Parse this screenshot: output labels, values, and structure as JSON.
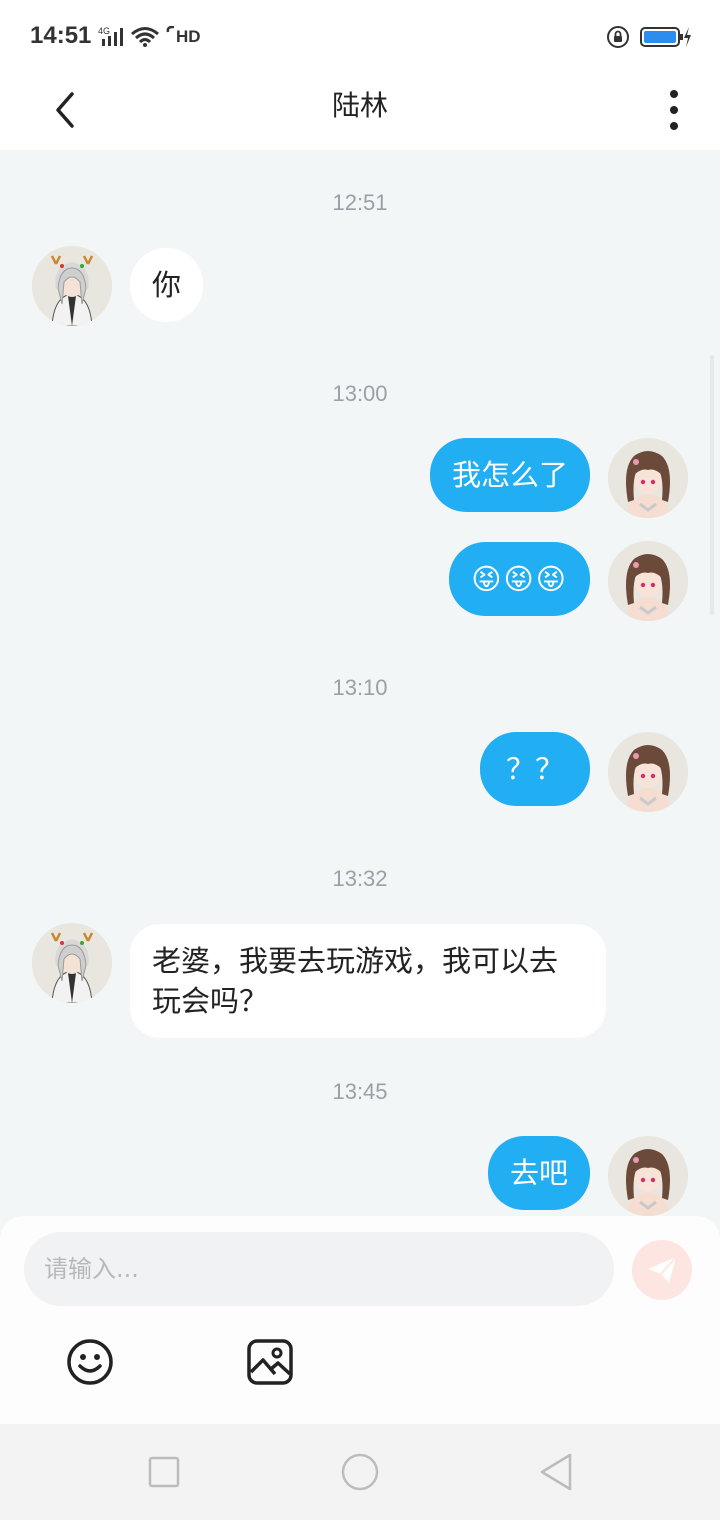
{
  "status_bar": {
    "time": "14:51",
    "network": "4G",
    "hd": "HD",
    "icons": [
      "signal-icon",
      "wifi-icon",
      "hd-call-icon",
      "rotation-lock-icon",
      "battery-charging-icon"
    ],
    "battery_color": "#2d8cf0"
  },
  "header": {
    "title": "陆林",
    "back_icon": "chevron-left-icon",
    "more_icon": "more-vertical-icon"
  },
  "messages": [
    {
      "timestamp": "12:51"
    },
    {
      "direction": "in",
      "text": "你",
      "sender": "contact"
    },
    {
      "timestamp": "13:00"
    },
    {
      "direction": "out",
      "text": "我怎么了",
      "sender": "me"
    },
    {
      "direction": "out",
      "text": "😝😝😝",
      "sender": "me"
    },
    {
      "timestamp": "13:10"
    },
    {
      "direction": "out",
      "text": "？？",
      "sender": "me"
    },
    {
      "timestamp": "13:32"
    },
    {
      "direction": "in",
      "text": "老婆，我要去玩游戏，我可以去玩会吗？",
      "sender": "contact"
    },
    {
      "timestamp": "13:45"
    },
    {
      "direction": "out",
      "text": "去吧",
      "sender": "me"
    }
  ],
  "composer": {
    "placeholder": "请输入...",
    "send_icon": "send-icon",
    "tools": [
      "emoji-icon",
      "image-icon"
    ]
  },
  "nav_bar": {
    "buttons": [
      "recents-square-icon",
      "home-circle-icon",
      "back-triangle-icon"
    ]
  },
  "colors": {
    "accent": "#22aef2",
    "chat_background": "#f3f6f7",
    "send_button": "#fde5e1"
  }
}
